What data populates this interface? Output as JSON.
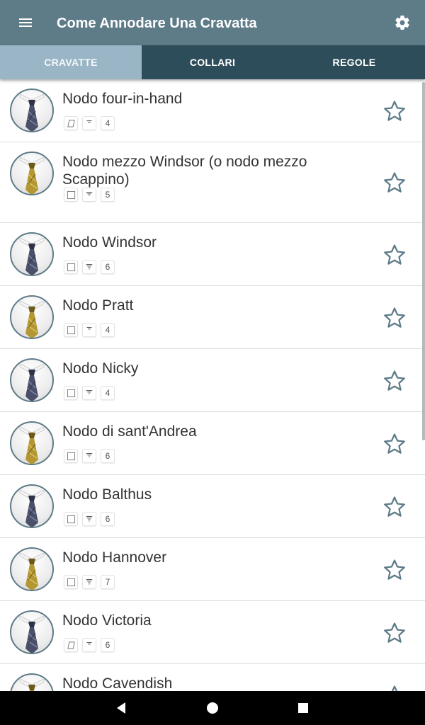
{
  "app": {
    "title": "Come Annodare Una Cravatta",
    "bar_color": "#5e7b88",
    "tabs_color": "#2e4d5a",
    "active_tab_color": "#9ab6c6",
    "menu_icon": "hamburger-menu-icon",
    "settings_icon": "gear-icon"
  },
  "tabs": [
    {
      "label": "CRAVATTE",
      "active": true
    },
    {
      "label": "COLLARI",
      "active": false
    },
    {
      "label": "REGOLE",
      "active": false
    }
  ],
  "knots": [
    {
      "name": "Nodo four-in-hand",
      "tie": "navy",
      "shape_icon": "slanted-knot-icon",
      "size_icon": "knot-size-small-icon",
      "steps": "4"
    },
    {
      "name": "Nodo mezzo Windsor (o nodo mezzo Scappino)",
      "tie": "gold",
      "shape_icon": "square-knot-icon",
      "size_icon": "knot-size-medium-icon",
      "steps": "5"
    },
    {
      "name": "Nodo Windsor",
      "tie": "navy",
      "shape_icon": "square-knot-icon",
      "size_icon": "knot-size-large-icon",
      "steps": "6"
    },
    {
      "name": "Nodo Pratt",
      "tie": "gold",
      "shape_icon": "square-knot-icon",
      "size_icon": "knot-size-small-icon",
      "steps": "4"
    },
    {
      "name": "Nodo Nicky",
      "tie": "navy",
      "shape_icon": "square-knot-icon",
      "size_icon": "knot-size-medium-icon",
      "steps": "4"
    },
    {
      "name": "Nodo di sant'Andrea",
      "tie": "gold",
      "shape_icon": "square-knot-icon",
      "size_icon": "knot-size-medium-icon",
      "steps": "6"
    },
    {
      "name": "Nodo Balthus",
      "tie": "navy",
      "shape_icon": "square-knot-icon",
      "size_icon": "knot-size-large-icon",
      "steps": "6"
    },
    {
      "name": "Nodo Hannover",
      "tie": "gold",
      "shape_icon": "square-knot-icon",
      "size_icon": "knot-size-large-icon",
      "steps": "7"
    },
    {
      "name": "Nodo Victoria",
      "tie": "navy",
      "shape_icon": "slanted-knot-icon",
      "size_icon": "knot-size-small-icon",
      "steps": "6"
    },
    {
      "name": "Nodo Cavendish",
      "tie": "gold",
      "shape_icon": "square-knot-icon",
      "size_icon": "knot-size-medium-icon",
      "steps": ""
    }
  ],
  "favorite_icon": "star-outline-icon",
  "navbar": {
    "back_icon": "back-triangle-icon",
    "home_icon": "home-circle-icon",
    "recents_icon": "recents-square-icon"
  }
}
